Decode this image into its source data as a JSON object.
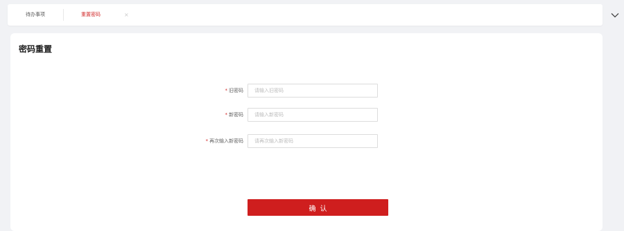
{
  "tabs": [
    {
      "label": "待办事项",
      "active": false
    },
    {
      "label": "重置密码",
      "active": true,
      "closable": true
    }
  ],
  "tab_close_glyph": "×",
  "dropdown_icon": "chevron-down-icon",
  "panel": {
    "title": "密码重置"
  },
  "form": {
    "required_mark": "*",
    "fields": [
      {
        "label": "旧密码",
        "placeholder": "请输入旧密码",
        "value": ""
      },
      {
        "label": "新密码",
        "placeholder": "请输入新密码",
        "value": ""
      },
      {
        "label": "再次输入新密码",
        "placeholder": "请再次输入新密码",
        "value": ""
      }
    ],
    "submit_label": "确认"
  },
  "colors": {
    "accent": "#cf1e1e",
    "active_tab_text": "#d22b2b",
    "background": "#f1f2f5",
    "surface": "#ffffff"
  }
}
